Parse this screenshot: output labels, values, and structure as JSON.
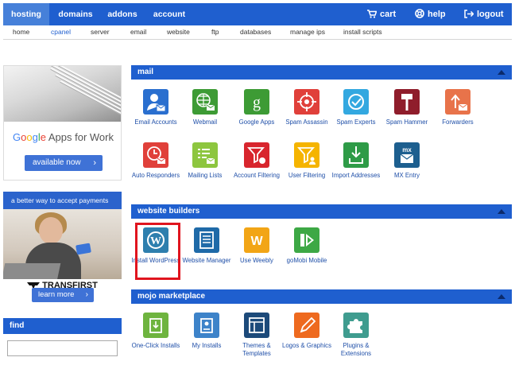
{
  "topnav": {
    "items": [
      "hosting",
      "domains",
      "addons",
      "account"
    ],
    "cart": "cart",
    "help": "help",
    "logout": "logout"
  },
  "subnav": [
    "home",
    "cpanel",
    "server",
    "email",
    "website",
    "ftp",
    "databases",
    "manage ips",
    "install scripts"
  ],
  "sidebar": {
    "google_ad": {
      "google": "Google",
      "rest": "Apps for Work",
      "button": "available now"
    },
    "payment_ad": {
      "header": "a better way to accept payments",
      "brand": "TRANSFIRST",
      "button": "learn more"
    },
    "find": {
      "title": "find",
      "input_value": ""
    }
  },
  "sections": {
    "mail": {
      "title": "mail",
      "tiles": [
        {
          "label": "Email Accounts",
          "color": "#2a6fcf"
        },
        {
          "label": "Webmail",
          "color": "#3d9b35"
        },
        {
          "label": "Google Apps",
          "color": "#3d9b35"
        },
        {
          "label": "Spam Assassin",
          "color": "#e0403a"
        },
        {
          "label": "Spam Experts",
          "color": "#33a8e0"
        },
        {
          "label": "Spam Hammer",
          "color": "#8f1d2b"
        },
        {
          "label": "Forwarders",
          "color": "#e8734a"
        },
        {
          "label": "Auto Responders",
          "color": "#e0403a"
        },
        {
          "label": "Mailing Lists",
          "color": "#8dc63f"
        },
        {
          "label": "Account Filtering",
          "color": "#d8252d"
        },
        {
          "label": "User Filtering",
          "color": "#f5b400"
        },
        {
          "label": "Import Addresses",
          "color": "#2e9b47"
        },
        {
          "label": "MX Entry",
          "color": "#1d5f8f"
        }
      ]
    },
    "website_builders": {
      "title": "website builders",
      "tiles": [
        {
          "label": "Install WordPress",
          "color": "#2e7fae"
        },
        {
          "label": "Website Manager",
          "color": "#1f6aa8"
        },
        {
          "label": "Use Weebly",
          "color": "#f2a516"
        },
        {
          "label": "goMobi Mobile",
          "color": "#3da845"
        }
      ]
    },
    "mojo": {
      "title": "mojo marketplace",
      "tiles": [
        {
          "label": "One-Click Installs",
          "color": "#6eb43f"
        },
        {
          "label": "My Installs",
          "color": "#3d83c9"
        },
        {
          "label": "Themes & Templates",
          "color": "#1c4a7a"
        },
        {
          "label": "Logos & Graphics",
          "color": "#ee6a1f"
        },
        {
          "label": "Plugins & Extensions",
          "color": "#3f9c8f"
        }
      ]
    }
  }
}
